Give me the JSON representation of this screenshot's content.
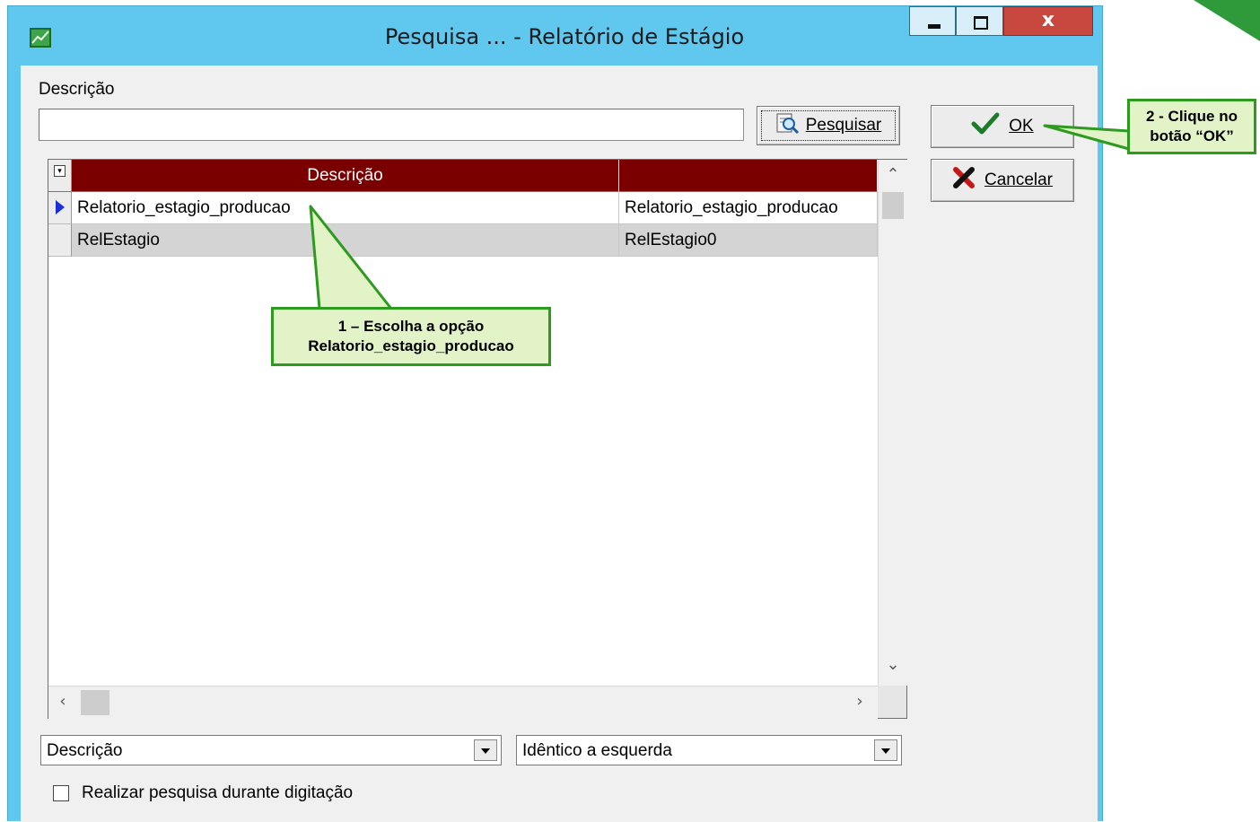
{
  "window": {
    "title": "Pesquisa ... - Relatório de Estágio",
    "minimize_icon": "minimize-icon",
    "maximize_icon": "maximize-icon",
    "close_label": "x"
  },
  "search": {
    "label": "Descrição",
    "value": "",
    "button_label": "Pesquisar",
    "button_icon": "search-icon"
  },
  "actions": {
    "ok_label": "OK",
    "ok_icon": "checkmark-icon",
    "cancel_label": "Cancelar",
    "cancel_icon": "x-icon"
  },
  "grid": {
    "columns": [
      "Descrição",
      ""
    ],
    "rows": [
      {
        "col1": "Relatorio_estagio_producao",
        "col2": "Relatorio_estagio_producao",
        "selected": true
      },
      {
        "col1": "RelEstagio",
        "col2": "RelEstagio0",
        "selected": false
      }
    ]
  },
  "filters": {
    "field_value": "Descrição",
    "mode_value": "Idêntico a esquerda"
  },
  "options": {
    "live_search_label": "Realizar pesquisa durante digitação",
    "live_search_checked": false
  },
  "annotations": {
    "step1_line1": "1 – Escolha a opção",
    "step1_line2": "Relatorio_estagio_producao",
    "step2_line1": "2 - Clique no",
    "step2_line2": "botão “OK”"
  },
  "colors": {
    "titlebar": "#60c7ee",
    "grid_header": "#7a0000",
    "callout_border": "#2e9a1f",
    "callout_fill": "#e2f3c8"
  }
}
